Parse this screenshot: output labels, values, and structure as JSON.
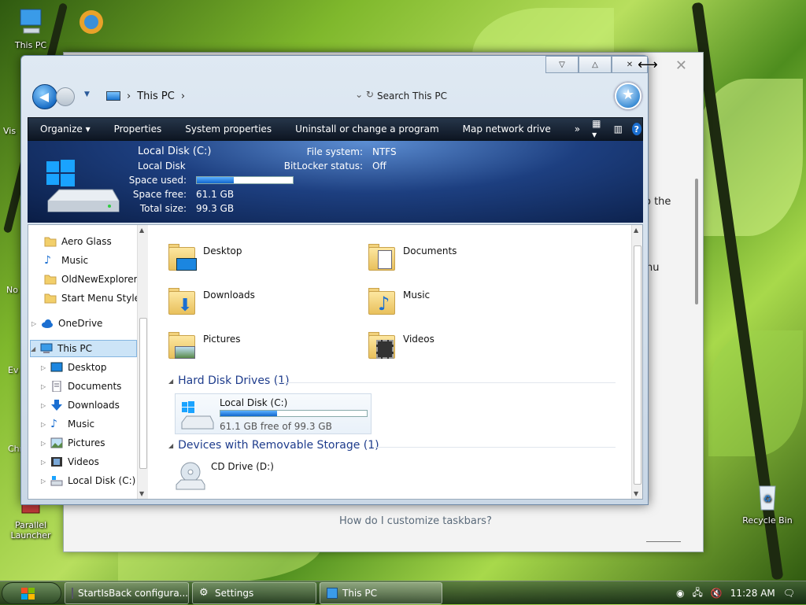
{
  "desktop": {
    "icons": [
      {
        "label": "This PC"
      },
      {
        "label": "Parallel\nLauncher"
      },
      {
        "label": "Recycle Bin"
      }
    ],
    "partial_labels": [
      "Vis",
      "No",
      "Ev",
      "Chr"
    ]
  },
  "background_window": {
    "text_fragments": [
      "o the",
      "nu"
    ],
    "question": "How do I customize taskbars?"
  },
  "explorer": {
    "address": {
      "crumb": "This PC"
    },
    "search_placeholder": "Search This PC",
    "toolbar": {
      "items": [
        "Organize ▾",
        "Properties",
        "System properties",
        "Uninstall or change a program",
        "Map network drive"
      ],
      "more": "»",
      "help": "?"
    },
    "details": {
      "name": "Local Disk (C:)",
      "type": "Local Disk",
      "space_used_label": "Space used:",
      "space_used_fraction": 0.385,
      "space_free_label": "Space free:",
      "space_free": "61.1 GB",
      "total_size_label": "Total size:",
      "total_size": "99.3 GB",
      "file_system_label": "File system:",
      "file_system": "NTFS",
      "bitlocker_label": "BitLocker status:",
      "bitlocker": "Off"
    },
    "nav_pane": {
      "items": [
        {
          "label": "Aero Glass"
        },
        {
          "label": "Music"
        },
        {
          "label": "OldNewExplorer"
        },
        {
          "label": "Start Menu Style"
        },
        {
          "label": "OneDrive"
        },
        {
          "label": "This PC"
        },
        {
          "label": "Desktop"
        },
        {
          "label": "Documents"
        },
        {
          "label": "Downloads"
        },
        {
          "label": "Music"
        },
        {
          "label": "Pictures"
        },
        {
          "label": "Videos"
        },
        {
          "label": "Local Disk (C:)"
        }
      ]
    },
    "folders": [
      {
        "name": "Desktop"
      },
      {
        "name": "Documents"
      },
      {
        "name": "Downloads"
      },
      {
        "name": "Music"
      },
      {
        "name": "Pictures"
      },
      {
        "name": "Videos"
      }
    ],
    "groups": {
      "hard_disk": "Hard Disk Drives (1)",
      "removable": "Devices with Removable Storage (1)"
    },
    "drives": {
      "local": {
        "name": "Local Disk (C:)",
        "free_text": "61.1 GB free of 99.3 GB",
        "used_fraction": 0.385
      },
      "cd": {
        "name": "CD Drive (D:)"
      }
    }
  },
  "taskbar": {
    "buttons": [
      {
        "label": "StartIsBack configura..."
      },
      {
        "label": "Settings"
      },
      {
        "label": "This PC"
      }
    ],
    "clock": "11:28 AM"
  },
  "colors": {
    "accent": "#1b6fd1",
    "toolbar_bg": "#1a2636",
    "details_bg": "#1d3f80",
    "group_header": "#1e3c8c"
  }
}
